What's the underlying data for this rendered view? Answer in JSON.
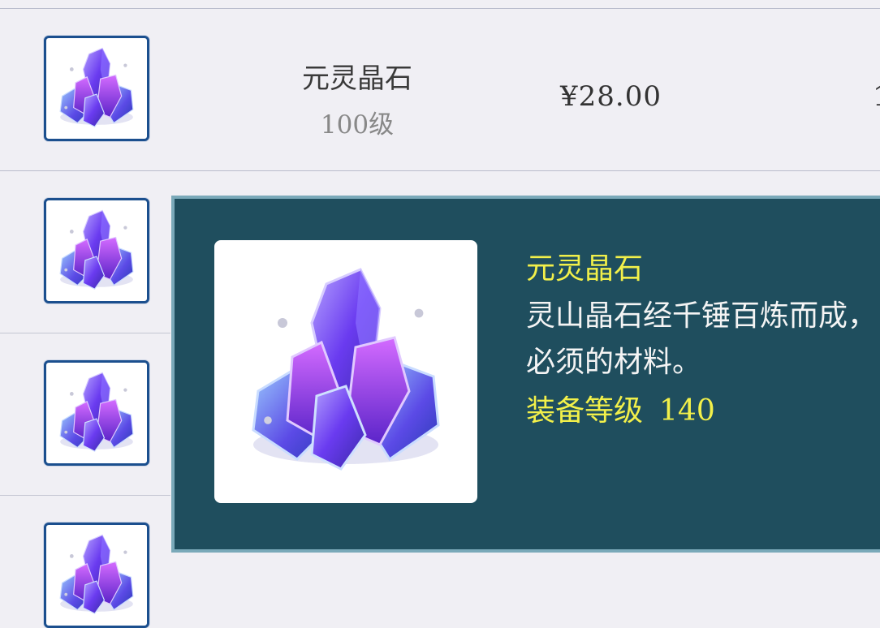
{
  "item": {
    "name": "元灵晶石",
    "level": "100级",
    "price": "¥28.00",
    "truncated_edge_text": "1"
  },
  "tooltip": {
    "name": "元灵晶石",
    "description_line1": "灵山晶石经千锤百炼而成，",
    "description_line2": "必须的材料。",
    "level_label": "装备等级",
    "level_value": "140"
  },
  "icons": {
    "crystal": "purple-crystal-cluster-icon"
  },
  "colors": {
    "tooltip_bg": "#1f4e5e",
    "tooltip_highlight": "#f2f04a",
    "icon_border": "#1b4f8e"
  }
}
